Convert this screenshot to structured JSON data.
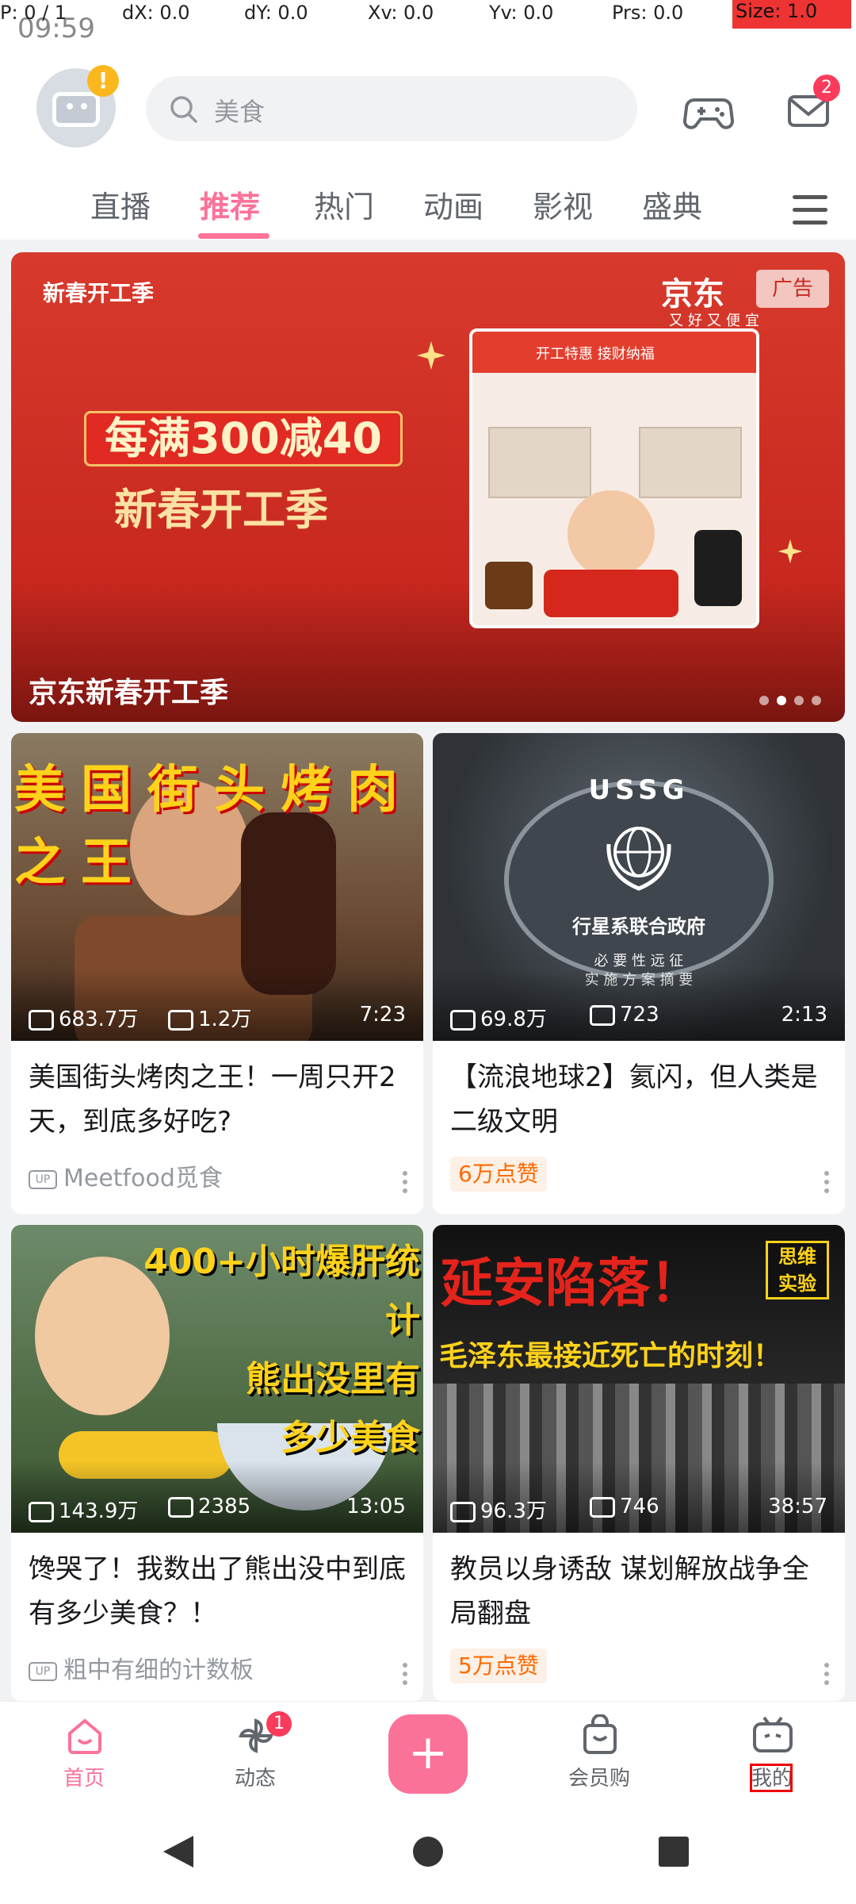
{
  "status": {
    "time": "09:59",
    "debug": {
      "p": "P: 0 / 1",
      "dx": "dX: 0.0",
      "dy": "dY: 0.0",
      "xv": "Xv: 0.0",
      "yv": "Yv: 0.0",
      "prs": "Prs: 0.0",
      "size": "Size: 1.0"
    }
  },
  "header": {
    "avatar_badge": "!",
    "search_placeholder": "美食",
    "mail_badge": "2"
  },
  "tabs": [
    {
      "label": "直播"
    },
    {
      "label": "推荐",
      "active": true
    },
    {
      "label": "热门"
    },
    {
      "label": "动画"
    },
    {
      "label": "影视"
    },
    {
      "label": "盛典"
    }
  ],
  "banner": {
    "brand_left": "新春开工季",
    "brand_right": "京东",
    "brand_right_sub": "又好又便宜",
    "ad_tag": "广告",
    "promo_line1": "每满300减40",
    "promo_line2": "新春开工季",
    "card_strip": "开工特惠 接财纳福",
    "title": "京东新春开工季"
  },
  "feed": [
    {
      "thumb_text": "美国街头烤肉之王",
      "views": "683.7万",
      "danmaku": "1.2万",
      "duration": "7:23",
      "title": "美国街头烤肉之王！一周只开2天，到底多好吃?",
      "meta_type": "up",
      "meta": "Meetfood觅食"
    },
    {
      "thumb_text": "USSG",
      "thumb_sub": "行星系联合政府",
      "thumb_sub2": "必 要 性 远 征\n实 施 方 案 摘 要",
      "views": "69.8万",
      "danmaku": "723",
      "duration": "2:13",
      "title": "【流浪地球2】氦闪，但人类是二级文明",
      "meta_type": "like",
      "meta": "6万点赞"
    },
    {
      "thumb_text": "400+小时爆肝统计\n熊出没里有\n多少美食",
      "views": "143.9万",
      "danmaku": "2385",
      "duration": "13:05",
      "title": "馋哭了！我数出了熊出没中到底有多少美食？！",
      "meta_type": "up",
      "meta": "粗中有细的计数板"
    },
    {
      "thumb_text": "延安陷落！",
      "thumb_sub": "毛泽东最接近死亡的时刻！",
      "thumb_badge": "思维\n实验",
      "views": "96.3万",
      "danmaku": "746",
      "duration": "38:57",
      "title": "教员以身诱敌 谋划解放战争全局翻盘",
      "meta_type": "like",
      "meta": "5万点赞"
    }
  ],
  "bottom_nav": [
    {
      "label": "首页",
      "active": true
    },
    {
      "label": "动态",
      "badge": "1"
    },
    {
      "label": "+"
    },
    {
      "label": "会员购"
    },
    {
      "label": "我的"
    }
  ],
  "colors": {
    "accent": "#fb7299",
    "badge": "#fb3b5c",
    "banner_red": "#d73a2c"
  }
}
